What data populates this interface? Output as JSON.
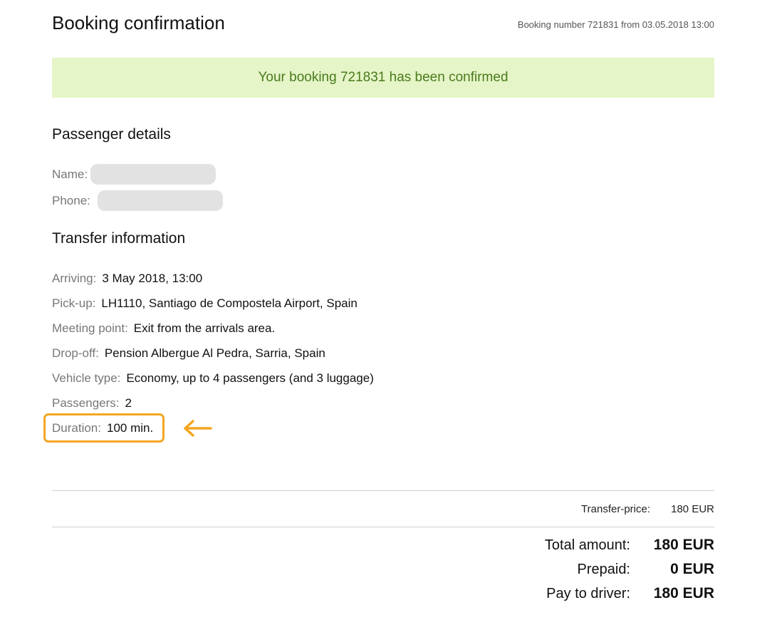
{
  "header": {
    "title": "Booking confirmation",
    "booking_number_text": "Booking number 721831 from 03.05.2018 13:00"
  },
  "banner": {
    "message": "Your booking 721831 has been confirmed",
    "background_color": "#e5f5c7",
    "text_color": "#4a7a1c"
  },
  "passenger": {
    "title": "Passenger details",
    "name_label": "Name:",
    "phone_label": "Phone:"
  },
  "transfer": {
    "title": "Transfer information",
    "arriving_label": "Arriving:",
    "arriving_value": "3 May 2018, 13:00",
    "pickup_label": "Pick-up:",
    "pickup_value": "LH1110, Santiago de Compostela Airport, Spain",
    "meeting_label": "Meeting point:",
    "meeting_value": "Exit from the arrivals area.",
    "dropoff_label": "Drop-off:",
    "dropoff_value": "Pension Albergue Al Pedra, Sarria, Spain",
    "vehicle_label": "Vehicle type:",
    "vehicle_value": "Economy, up to 4 passengers (and 3 luggage)",
    "passengers_label": "Passengers:",
    "passengers_value": "2",
    "duration_label": "Duration:",
    "duration_value": "100 min."
  },
  "annotation": {
    "highlight_color": "#f4a622",
    "arrow_icon": "arrow-left-icon"
  },
  "pricing": {
    "transfer_price_label": "Transfer-price:",
    "transfer_price_value": "180 EUR",
    "total_label": "Total amount:",
    "total_value": "180 EUR",
    "prepaid_label": "Prepaid:",
    "prepaid_value": "0 EUR",
    "pay_driver_label": "Pay to driver:",
    "pay_driver_value": "180 EUR"
  }
}
